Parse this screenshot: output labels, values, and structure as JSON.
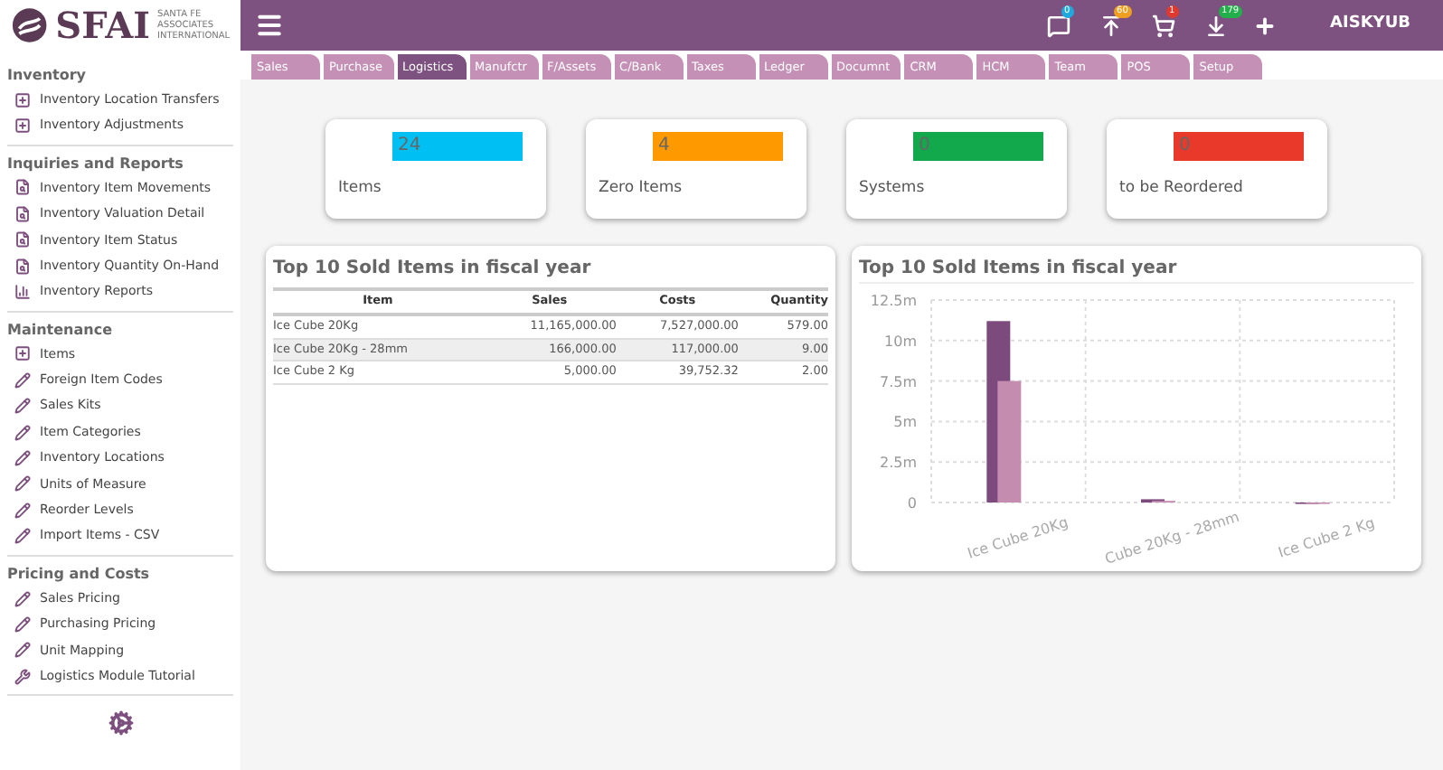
{
  "logo": {
    "mark": "SFAI",
    "company": "SANTA FE ASSOCIATES INTERNATIONAL"
  },
  "header": {
    "notifications": [
      {
        "kind": "message",
        "count": "0",
        "color": "#1fa9dd"
      },
      {
        "kind": "upload",
        "count": "60",
        "color": "#f0a020"
      },
      {
        "kind": "cart",
        "count": "1",
        "color": "#e03a2e"
      },
      {
        "kind": "download",
        "count": "179",
        "color": "#22b04a"
      }
    ],
    "user": "AISKYUB"
  },
  "tabs": [
    {
      "label": "Sales",
      "selected": false
    },
    {
      "label": "Purchase",
      "selected": false
    },
    {
      "label": "Logistics",
      "selected": true
    },
    {
      "label": "Manufctr",
      "selected": false
    },
    {
      "label": "F/Assets",
      "selected": false
    },
    {
      "label": "C/Bank",
      "selected": false
    },
    {
      "label": "Taxes",
      "selected": false
    },
    {
      "label": "Ledger",
      "selected": false
    },
    {
      "label": "Documnt",
      "selected": false
    },
    {
      "label": "CRM",
      "selected": false
    },
    {
      "label": "HCM",
      "selected": false
    },
    {
      "label": "Team",
      "selected": false
    },
    {
      "label": "POS",
      "selected": false
    },
    {
      "label": "Setup",
      "selected": false
    }
  ],
  "sidebar": [
    {
      "title": "Inventory",
      "items": [
        {
          "label": "Inventory Location Transfers",
          "kind": "add"
        },
        {
          "label": "Inventory Adjustments",
          "kind": "add"
        }
      ]
    },
    {
      "title": "Inquiries and Reports",
      "items": [
        {
          "label": "Inventory Item Movements",
          "kind": "inquiry"
        },
        {
          "label": "Inventory Valuation Detail",
          "kind": "inquiry"
        },
        {
          "label": "Inventory Item Status",
          "kind": "inquiry"
        },
        {
          "label": "Inventory Quantity On-Hand",
          "kind": "inquiry"
        },
        {
          "label": "Inventory Reports",
          "kind": "report"
        }
      ]
    },
    {
      "title": "Maintenance",
      "items": [
        {
          "label": "Items",
          "kind": "add"
        },
        {
          "label": "Foreign Item Codes",
          "kind": "edit"
        },
        {
          "label": "Sales Kits",
          "kind": "edit"
        },
        {
          "label": "Item Categories",
          "kind": "edit"
        },
        {
          "label": "Inventory Locations",
          "kind": "edit"
        },
        {
          "label": "Units of Measure",
          "kind": "edit"
        },
        {
          "label": "Reorder Levels",
          "kind": "edit"
        },
        {
          "label": "Import Items - CSV",
          "kind": "edit"
        }
      ]
    },
    {
      "title": "Pricing and Costs",
      "items": [
        {
          "label": "Sales Pricing",
          "kind": "edit"
        },
        {
          "label": "Purchasing Pricing",
          "kind": "edit"
        },
        {
          "label": "Unit Mapping",
          "kind": "edit"
        },
        {
          "label": "Logistics Module Tutorial",
          "kind": "tool"
        }
      ]
    }
  ],
  "tiles": [
    {
      "value": "24",
      "label": "Items",
      "color": "#00bff3"
    },
    {
      "value": "4",
      "label": "Zero Items",
      "color": "#ff9900"
    },
    {
      "value": "0",
      "label": "Systems",
      "color": "#12a84c"
    },
    {
      "value": "0",
      "label": "to be Reordered",
      "color": "#e8392a"
    }
  ],
  "table": {
    "title": "Top 10 Sold Items in fiscal year",
    "columns": [
      "Item",
      "Sales",
      "Costs",
      "Quantity"
    ],
    "rows": [
      [
        "Ice Cube 20Kg",
        "11,165,000.00",
        "7,527,000.00",
        "579.00"
      ],
      [
        "Ice Cube 20Kg - 28mm",
        "166,000.00",
        "117,000.00",
        "9.00"
      ],
      [
        "Ice Cube 2 Kg",
        "5,000.00",
        "39,752.32",
        "2.00"
      ]
    ]
  },
  "chart": {
    "title": "Top 10 Sold Items in fiscal year",
    "chart_data": {
      "type": "bar",
      "categories": [
        "Ice Cube 20Kg",
        "Cube 20Kg - 28mm",
        "Ice Cube 2 Kg"
      ],
      "grid": true,
      "series": [
        {
          "color": "#7d4a7e",
          "values": [
            11200000,
            200000,
            0
          ]
        },
        {
          "color": "#c48db0",
          "values": [
            7500000,
            100000,
            0
          ]
        }
      ],
      "ylim": [
        0,
        12500000
      ],
      "yticks": [
        {
          "value": 0,
          "label": "0"
        },
        {
          "value": 2500000,
          "label": "2.5m"
        },
        {
          "value": 5000000,
          "label": "5m"
        },
        {
          "value": 7500000,
          "label": "7.5m"
        },
        {
          "value": 10000000,
          "label": "10m"
        },
        {
          "value": 12500000,
          "label": "12.5m"
        }
      ]
    }
  }
}
